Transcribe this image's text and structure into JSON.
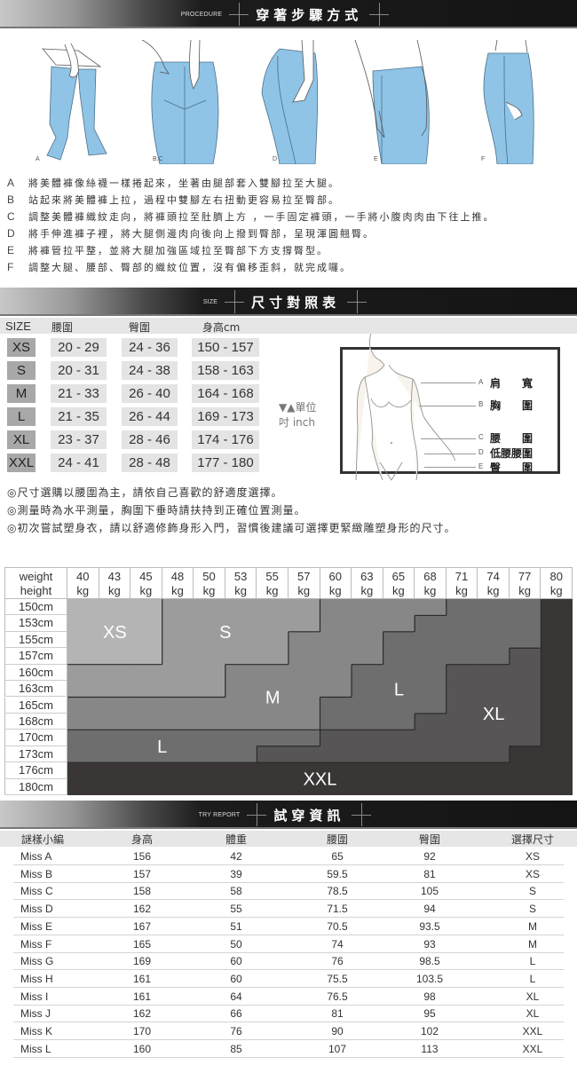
{
  "procedure": {
    "banner_sub": "PROCEDURE",
    "banner_title": "穿著步驟方式",
    "figure_labels": [
      "A",
      "B.C",
      "D",
      "E",
      "F"
    ],
    "steps": [
      {
        "key": "A",
        "text": "將美體褲像絲襪一樣捲起來，坐著由腿部套入雙腳拉至大腿。"
      },
      {
        "key": "B",
        "text": "站起來將美體褲上拉，過程中雙腳左右扭動更容易拉至臀部。"
      },
      {
        "key": "C",
        "text": "調整美體褲織紋走向，將褲頭拉至肚臍上方 ，一手固定褲頭，一手將小腹肉肉由下往上推。"
      },
      {
        "key": "D",
        "text": "將手伸進褲子裡，將大腿側邊肉向後向上撥到臀部，呈現渾圓翹臀。"
      },
      {
        "key": "E",
        "text": "將褲管拉平整，並將大腿加強區域拉至臀部下方支撐臀型。"
      },
      {
        "key": "F",
        "text": "調整大腿、腰部、臀部的織紋位置，沒有偏移歪斜，就完成囉。"
      }
    ]
  },
  "size_table": {
    "banner_sub": "SIZE",
    "banner_title": "尺寸對照表",
    "headers": [
      "SIZE",
      "腰圍",
      "臀圍",
      "身高cm"
    ],
    "rows": [
      [
        "XS",
        "20 - 29",
        "24 - 36",
        "150 - 157"
      ],
      [
        "S",
        "20 - 31",
        "24 - 38",
        "158 - 163"
      ],
      [
        "M",
        "21 - 33",
        "26 - 40",
        "164 - 168"
      ],
      [
        "L",
        "21 - 35",
        "26 - 44",
        "169 - 173"
      ],
      [
        "XL",
        "23 - 37",
        "28 - 46",
        "174 - 176"
      ],
      [
        "XXL",
        "24 - 41",
        "28 - 48",
        "177 - 180"
      ]
    ],
    "unit_line1": "▼▲單位",
    "unit_line2": "吋 inch",
    "measurements": [
      {
        "key": "A",
        "label": "肩　　寬"
      },
      {
        "key": "B",
        "label": "胸　　圍"
      },
      {
        "key": "C",
        "label": "腰　　圍"
      },
      {
        "key": "D",
        "label": "低腰腰圍"
      },
      {
        "key": "E",
        "label": "臀　　圍"
      }
    ],
    "notes": [
      "◎尺寸選購以腰圍為主，請依自己喜歡的舒適度選擇。",
      "◎測量時為水平測量，胸圍下垂時請扶持到正確位置測量。",
      "◎初次嘗試塑身衣，請以舒適修飾身形入門，習慣後建議可選擇更緊緻雕塑身形的尺寸。"
    ]
  },
  "chart_data": {
    "type": "heatmap",
    "title": "",
    "xlabel": "weight",
    "ylabel": "height",
    "x": [
      "40 kg",
      "43 kg",
      "45 kg",
      "48 kg",
      "50 kg",
      "53 kg",
      "55 kg",
      "57 kg",
      "60 kg",
      "63 kg",
      "65 kg",
      "68 kg",
      "71 kg",
      "74 kg",
      "77 kg",
      "80 kg"
    ],
    "y": [
      "150cm",
      "153cm",
      "155cm",
      "157cm",
      "160cm",
      "163cm",
      "165cm",
      "168cm",
      "170cm",
      "173cm",
      "176cm",
      "180cm"
    ],
    "legend": [
      "XS",
      "S",
      "M",
      "L",
      "XL",
      "XXL"
    ],
    "size_by_height_row": [
      [
        "XS",
        "XS",
        "XS",
        "S",
        "S",
        "S",
        "S",
        "S",
        "M",
        "M",
        "M",
        "M",
        "L",
        "L",
        "L",
        "XXL"
      ],
      [
        "XS",
        "XS",
        "XS",
        "S",
        "S",
        "S",
        "S",
        "S",
        "M",
        "M",
        "M",
        "L",
        "L",
        "L",
        "L",
        "XXL"
      ],
      [
        "XS",
        "XS",
        "XS",
        "S",
        "S",
        "S",
        "S",
        "M",
        "M",
        "M",
        "L",
        "L",
        "L",
        "L",
        "L",
        "XXL"
      ],
      [
        "XS",
        "XS",
        "XS",
        "S",
        "S",
        "S",
        "S",
        "M",
        "M",
        "M",
        "L",
        "L",
        "L",
        "L",
        "XL",
        "XXL"
      ],
      [
        "S",
        "S",
        "S",
        "S",
        "S",
        "M",
        "M",
        "M",
        "M",
        "L",
        "L",
        "L",
        "XL",
        "XL",
        "XL",
        "XXL"
      ],
      [
        "S",
        "S",
        "S",
        "S",
        "S",
        "M",
        "M",
        "M",
        "M",
        "L",
        "L",
        "L",
        "XL",
        "XL",
        "XL",
        "XXL"
      ],
      [
        "M",
        "M",
        "M",
        "M",
        "M",
        "M",
        "M",
        "M",
        "L",
        "L",
        "L",
        "L",
        "XL",
        "XL",
        "XL",
        "XXL"
      ],
      [
        "M",
        "M",
        "M",
        "M",
        "M",
        "M",
        "M",
        "M",
        "L",
        "L",
        "L",
        "XL",
        "XL",
        "XL",
        "XL",
        "XXL"
      ],
      [
        "L",
        "L",
        "L",
        "L",
        "L",
        "L",
        "L",
        "L",
        "XL",
        "XL",
        "XL",
        "XL",
        "XL",
        "XL",
        "XL",
        "XXL"
      ],
      [
        "L",
        "L",
        "L",
        "L",
        "L",
        "L",
        "XL",
        "XL",
        "XL",
        "XL",
        "XL",
        "XL",
        "XL",
        "XL",
        "XXL",
        "XXL"
      ],
      [
        "XXL",
        "XXL",
        "XXL",
        "XXL",
        "XXL",
        "XXL",
        "XXL",
        "XXL",
        "XXL",
        "XXL",
        "XXL",
        "XXL",
        "XXL",
        "XXL",
        "XXL",
        "XXL"
      ],
      [
        "XXL",
        "XXL",
        "XXL",
        "XXL",
        "XXL",
        "XXL",
        "XXL",
        "XXL",
        "XXL",
        "XXL",
        "XXL",
        "XXL",
        "XXL",
        "XXL",
        "XXL",
        "XXL"
      ]
    ],
    "region_labels": [
      {
        "text": "XS",
        "col": 1.5,
        "row": 2
      },
      {
        "text": "S",
        "col": 5,
        "row": 2
      },
      {
        "text": "M",
        "col": 6.5,
        "row": 6
      },
      {
        "text": "L",
        "col": 10.5,
        "row": 5.5
      },
      {
        "text": "XL",
        "col": 13.5,
        "row": 7
      },
      {
        "text": "L",
        "col": 3,
        "row": 9
      },
      {
        "text": "XXL",
        "col": 8,
        "row": 11
      }
    ],
    "colors": {
      "XS": "#b4b4b4",
      "S": "#9c9c9c",
      "M": "#878787",
      "L": "#6e6e6e",
      "XL": "#575555",
      "XXL": "#3a3636"
    }
  },
  "try_report": {
    "banner_sub": "TRY REPORT",
    "banner_title": "試穿資訊",
    "headers": [
      "謎樣小編",
      "身高",
      "體重",
      "腰圍",
      "臀圍",
      "選擇尺寸"
    ],
    "rows": [
      [
        "Miss A",
        "156",
        "42",
        "65",
        "92",
        "XS"
      ],
      [
        "Miss B",
        "157",
        "39",
        "59.5",
        "81",
        "XS"
      ],
      [
        "Miss C",
        "158",
        "58",
        "78.5",
        "105",
        "S"
      ],
      [
        "Miss D",
        "162",
        "55",
        "71.5",
        "94",
        "S"
      ],
      [
        "Miss E",
        "167",
        "51",
        "70.5",
        "93.5",
        "M"
      ],
      [
        "Miss F",
        "165",
        "50",
        "74",
        "93",
        "M"
      ],
      [
        "Miss G",
        "169",
        "60",
        "76",
        "98.5",
        "L"
      ],
      [
        "Miss H",
        "161",
        "60",
        "75.5",
        "103.5",
        "L"
      ],
      [
        "Miss  I",
        "161",
        "64",
        "76.5",
        "98",
        "XL"
      ],
      [
        "Miss J",
        "162",
        "66",
        "81",
        "95",
        "XL"
      ],
      [
        "Miss K",
        "170",
        "76",
        "90",
        "102",
        "XXL"
      ],
      [
        "Miss L",
        "160",
        "85",
        "107",
        "113",
        "XXL"
      ]
    ]
  }
}
